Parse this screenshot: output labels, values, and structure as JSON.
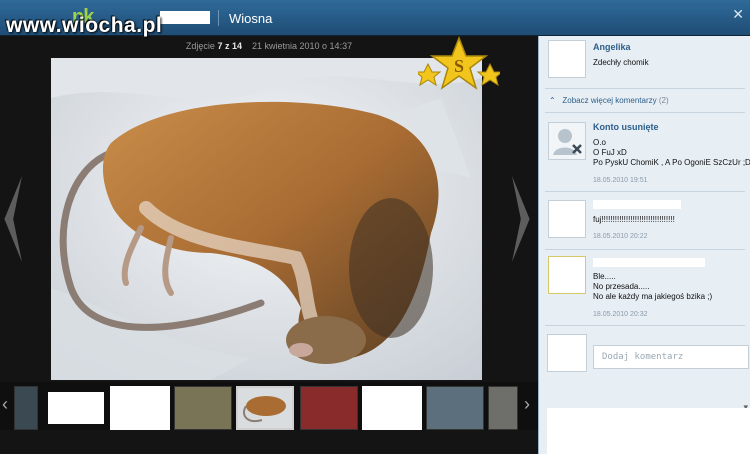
{
  "watermark": "www.wiocha.pl",
  "topbar": {
    "logo": "nk",
    "album_title": "Wiosna",
    "close_label": "✕"
  },
  "viewer": {
    "photo_label": "Zdjęcie",
    "photo_pos": "7 z 14",
    "photo_date": "21 kwietnia 2010 o 14:37",
    "star_icon": "gold-star-s-badge"
  },
  "sidebar": {
    "comments": [
      {
        "author": "Angelika",
        "lines": [
          "Zdechły chomik"
        ],
        "date": ""
      },
      {
        "author": "Konto usunięte",
        "lines": [
          "O.o",
          "O FuJ xD",
          "Po PyskU ChomiK , A Po OgoniE SzCzUr ;D"
        ],
        "date": "18.05.2010 19:51"
      },
      {
        "author": "",
        "lines": [
          "fuj!!!!!!!!!!!!!!!!!!!!!!!!!!!!!!!!!"
        ],
        "date": "18.05.2010 20:22"
      },
      {
        "author": "",
        "lines": [
          "Ble.....",
          "No przesada.....",
          "No ale każdy ma jakiegoś bzika ;)"
        ],
        "date": "18.05.2010 20:32"
      }
    ],
    "more_comments": "Zobacz więcej komentarzy",
    "more_count": "(2)",
    "add_placeholder": "Dodaj komentarz"
  },
  "colors": {
    "topbar": "#2f6a9a",
    "author_link": "#2d5f8a",
    "sidebar_bg": "#e7eef4"
  }
}
